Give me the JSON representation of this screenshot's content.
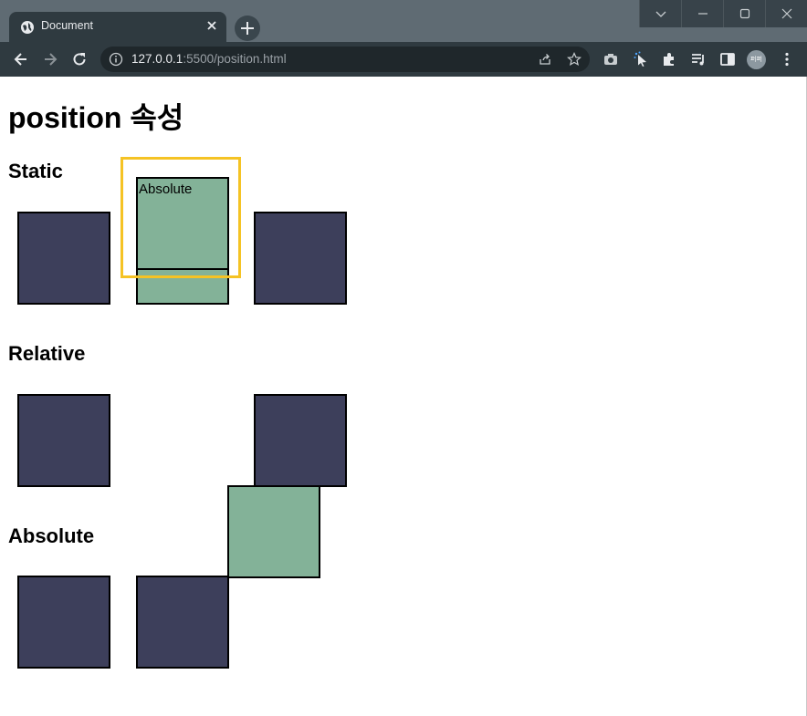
{
  "browser": {
    "tab_title": "Document",
    "url_host": "127.0.0.1",
    "url_path": ":5500/position.html",
    "profile_initials": "퍼퍼"
  },
  "page": {
    "title": "position 속성",
    "sections": {
      "static": "Static",
      "relative": "Relative",
      "absolute": "Absolute"
    },
    "box_label": "Absolute"
  },
  "colors": {
    "dark_box": "#3d3f5b",
    "green_box": "#83b298",
    "highlight": "#f5c324"
  },
  "icons": {
    "tab_favicon": "globe-icon",
    "tab_close": "close-icon",
    "new_tab": "plus-icon",
    "back": "arrow-left-icon",
    "forward": "arrow-right-icon",
    "reload": "reload-icon",
    "site_info": "info-icon",
    "share": "share-icon",
    "bookmark": "star-icon",
    "extensions": [
      "camera-icon",
      "cursor-icon",
      "puzzle-icon",
      "media-list-icon",
      "side-panel-icon"
    ],
    "menu": "kebab-menu-icon"
  }
}
